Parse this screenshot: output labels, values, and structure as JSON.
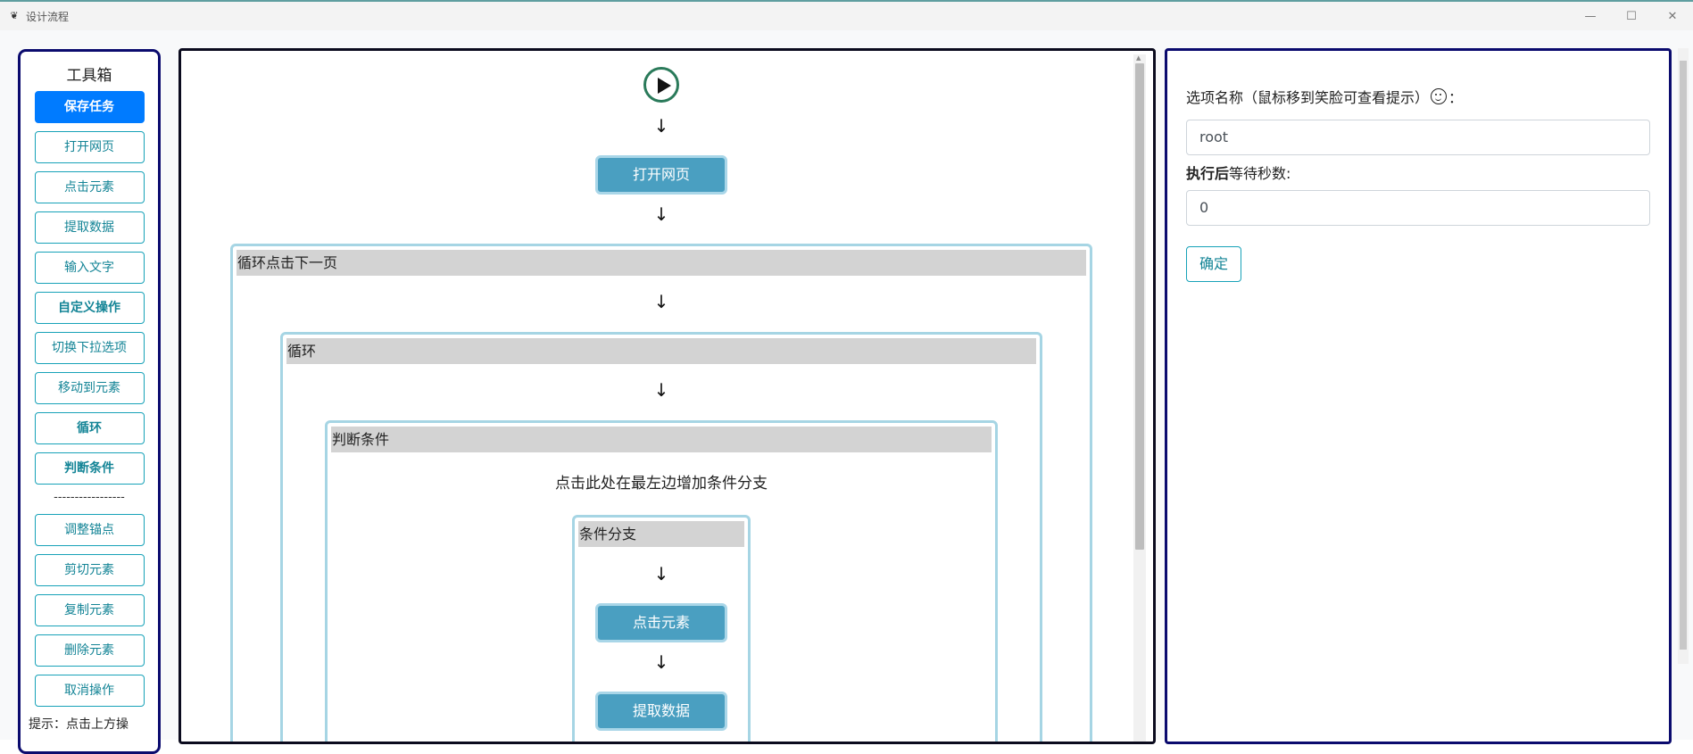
{
  "window": {
    "title": "设计流程",
    "controls": {
      "minimize": "—",
      "maximize": "☐",
      "close": "✕"
    }
  },
  "toolbox": {
    "title": "工具箱",
    "buttons": {
      "save": "保存任务",
      "open_page": "打开网页",
      "click_element": "点击元素",
      "extract_data": "提取数据",
      "input_text": "输入文字",
      "custom_action": "自定义操作",
      "switch_dropdown": "切换下拉选项",
      "move_to_element": "移动到元素",
      "loop": "循环",
      "condition": "判断条件",
      "adjust_anchor": "调整锚点",
      "cut_element": "剪切元素",
      "copy_element": "复制元素",
      "delete_element": "删除元素",
      "cancel_action": "取消操作"
    },
    "divider": "-----------------",
    "hint": "提示：点击上方操"
  },
  "flow": {
    "arrow": "↓",
    "open_page_node": "打开网页",
    "loop_next_page": "循环点击下一页",
    "loop": "循环",
    "condition": "判断条件",
    "condition_hint": "点击此处在最左边增加条件分支",
    "branch": "条件分支",
    "click_element_node": "点击元素",
    "extract_data_node": "提取数据"
  },
  "options": {
    "name_label": "选项名称（鼠标移到笑脸可查看提示）",
    "name_label_suffix": "：",
    "name_value": "root",
    "wait_label_bold": "执行后",
    "wait_label_rest": "等待秒数:",
    "wait_value": "0",
    "confirm_button": "确定"
  },
  "colors": {
    "primary": "#007bff",
    "info": "#17a2b8",
    "node": "#4a9fc1",
    "panel_border": "#0b0b6e"
  }
}
